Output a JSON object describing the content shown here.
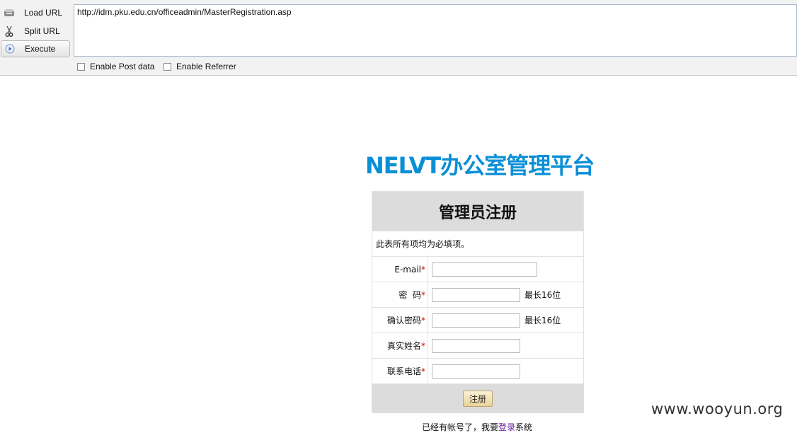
{
  "hackbar": {
    "load_label": "Load URL",
    "split_label": "Split URL",
    "execute_label": "Execute",
    "url_value": "http://idm.pku.edu.cn/officeadmin/MasterRegistration.asp",
    "post_label": "Enable Post data",
    "referrer_label": "Enable Referrer"
  },
  "page": {
    "site_title": "NELVT办公室管理平台",
    "form_title": "管理员注册",
    "note": "此表所有项均为必填项。",
    "fields": [
      {
        "label": "E-mail",
        "hint": ""
      },
      {
        "label": "密  码",
        "hint": "最长16位"
      },
      {
        "label": "确认密码",
        "hint": "最长16位"
      },
      {
        "label": "真实姓名",
        "hint": ""
      },
      {
        "label": "联系电话",
        "hint": ""
      }
    ],
    "required_mark": "*",
    "submit_label": "注册",
    "footer_prefix": "已经有帐号了，我要",
    "footer_link": "登录",
    "footer_suffix": "系统"
  },
  "watermark": "www.wooyun.org"
}
